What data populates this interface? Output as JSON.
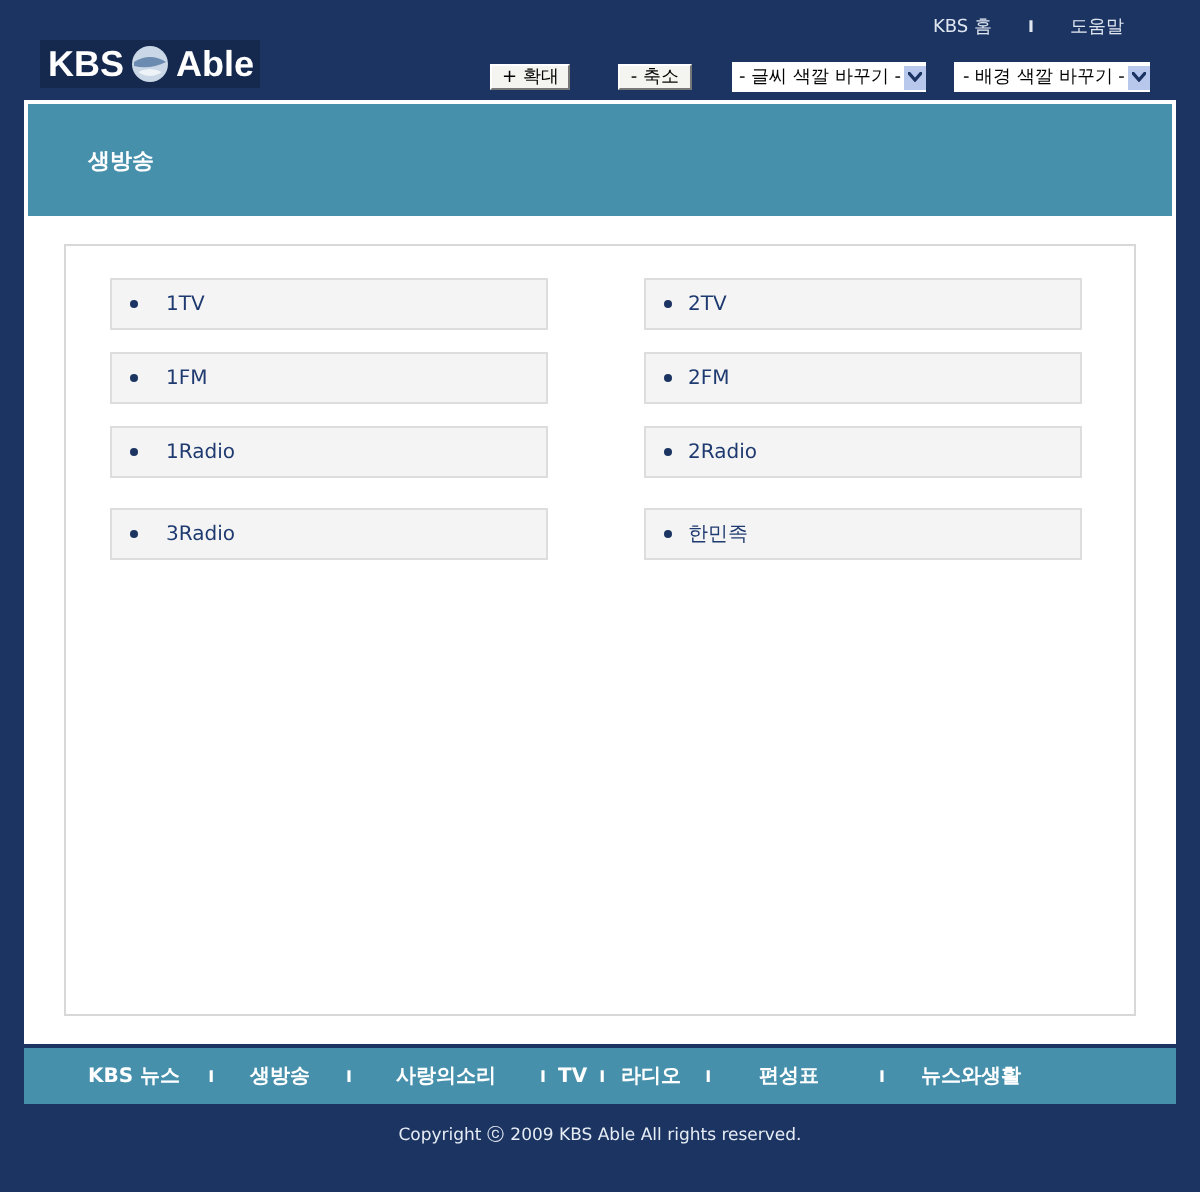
{
  "top_links": [
    "KBS 홈",
    "도움말"
  ],
  "top_link_separator": "I",
  "logo": {
    "left": "KBS",
    "right": "Able"
  },
  "zoom_buttons": [
    "+ 확대",
    "- 축소"
  ],
  "selects": [
    {
      "value": "- 글씨 색깔 바꾸기 -"
    },
    {
      "value": "- 배경 색깔 바꾸기 -"
    }
  ],
  "section_title": "생방송",
  "channels": [
    "1TV",
    "2TV",
    "1FM",
    "2FM",
    "1Radio",
    "2Radio",
    "3Radio",
    "한민족"
  ],
  "footer_nav": [
    "KBS 뉴스",
    "생방송",
    "사랑의소리",
    "TV",
    "라디오",
    "편성표",
    "뉴스와생활"
  ],
  "footer_separators": [
    "I",
    "I",
    "I",
    "I",
    "I",
    "I"
  ],
  "copyright": "Copyright ⓒ 2009 KBS Able All rights reserved."
}
